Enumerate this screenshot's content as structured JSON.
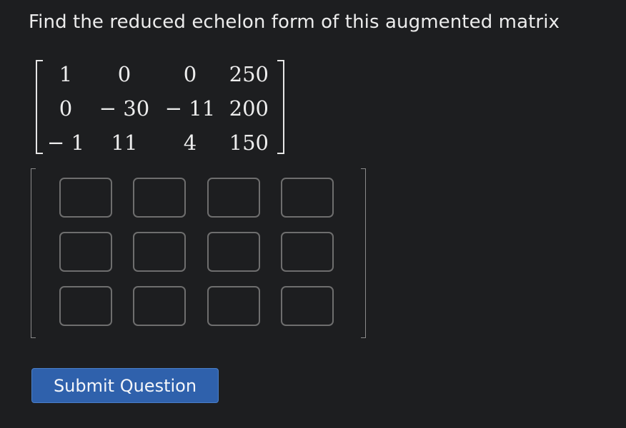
{
  "question": {
    "prompt": "Find the reduced echelon form of this augmented matrix"
  },
  "given_matrix": {
    "rows": [
      [
        "1",
        "0",
        "0",
        "250"
      ],
      [
        "0",
        "− 30",
        "− 11",
        "200"
      ],
      [
        "− 1",
        "11",
        "4",
        "150"
      ]
    ]
  },
  "answer_matrix": {
    "rows": [
      [
        "",
        "",
        "",
        ""
      ],
      [
        "",
        "",
        "",
        ""
      ],
      [
        "",
        "",
        "",
        ""
      ]
    ]
  },
  "actions": {
    "submit_label": "Submit Question"
  }
}
